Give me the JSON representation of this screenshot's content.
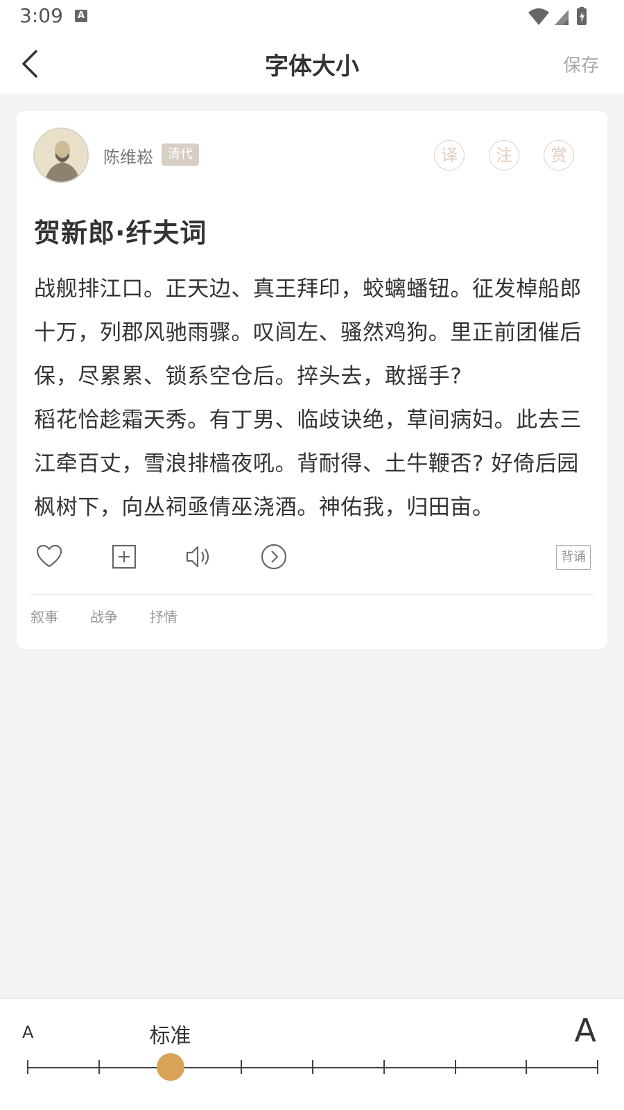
{
  "status_bar": {
    "time": "3:09",
    "notification_icon": "A"
  },
  "header": {
    "title": "字体大小",
    "save_label": "保存"
  },
  "poem": {
    "author": "陈维崧",
    "dynasty": "清代",
    "title": "贺新郎·纤夫词",
    "lines": [
      "战舰排江口。正天边、真王拜印，蛟螭蟠钮。征发棹船郎十万，列郡风驰雨骤。叹闾左、骚然鸡狗。里正前团催后保，尽累累、锁系空仓后。捽头去，敢摇手?",
      "稻花恰趁霜天秀。有丁男、临歧诀绝，草间病妇。此去三江牵百丈，雪浪排樯夜吼。背耐得、土牛鞭否? 好倚后园枫树下，向丛祠亟倩巫浇酒。神佑我，归田亩。"
    ]
  },
  "circle_buttons": {
    "translate": "译",
    "annotate": "注",
    "appreciate": "赏"
  },
  "actions": {
    "recite_label": "背诵"
  },
  "tags": [
    "叙事",
    "战争",
    "抒情"
  ],
  "font_size": {
    "small_label": "A",
    "large_label": "A",
    "current_label": "标准",
    "levels": 9,
    "current_level": 3
  },
  "colors": {
    "accent": "#d9a357",
    "badge": "#d7cfc3",
    "circle_icons": "#e2cfc0"
  }
}
